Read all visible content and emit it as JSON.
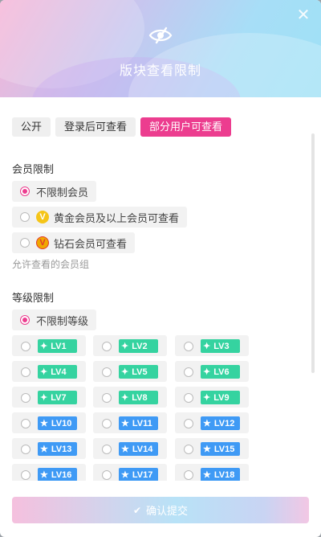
{
  "dialog": {
    "title": "版块查看限制",
    "eye_icon": "eye-slash-icon",
    "close_icon": "close-icon"
  },
  "tabs": [
    {
      "label": "公开",
      "active": false
    },
    {
      "label": "登录后可查看",
      "active": false
    },
    {
      "label": "部分用户可查看",
      "active": true
    }
  ],
  "member": {
    "heading": "会员限制",
    "options": [
      {
        "label": "不限制会员",
        "checked": true,
        "icon": ""
      },
      {
        "label": "黄金会员及以上会员可查看",
        "checked": false,
        "icon": "gold-vip-icon",
        "glyph": "V"
      },
      {
        "label": "钻石会员可查看",
        "checked": false,
        "icon": "diamond-vip-icon",
        "glyph": "V"
      }
    ],
    "hint": "允许查看的会员组"
  },
  "level": {
    "heading": "等级限制",
    "unlimited": {
      "label": "不限制等级",
      "checked": true
    },
    "levels": [
      {
        "label": "LV1",
        "color": "#35d3a0"
      },
      {
        "label": "LV2",
        "color": "#35d3a0"
      },
      {
        "label": "LV3",
        "color": "#35d3a0"
      },
      {
        "label": "LV4",
        "color": "#35d3a0"
      },
      {
        "label": "LV5",
        "color": "#35d3a0"
      },
      {
        "label": "LV6",
        "color": "#35d3a0"
      },
      {
        "label": "LV7",
        "color": "#35d3a0"
      },
      {
        "label": "LV8",
        "color": "#35d3a0"
      },
      {
        "label": "LV9",
        "color": "#35d3a0"
      },
      {
        "label": "LV10",
        "color": "#3f9af5"
      },
      {
        "label": "LV11",
        "color": "#3f9af5"
      },
      {
        "label": "LV12",
        "color": "#3f9af5"
      },
      {
        "label": "LV13",
        "color": "#3f9af5"
      },
      {
        "label": "LV14",
        "color": "#3f9af5"
      },
      {
        "label": "LV15",
        "color": "#3f9af5"
      },
      {
        "label": "LV16",
        "color": "#3f9af5"
      },
      {
        "label": "LV17",
        "color": "#3f9af5"
      },
      {
        "label": "LV18",
        "color": "#3f9af5"
      }
    ]
  },
  "submit": {
    "label": "确认提交",
    "icon": "check-icon"
  },
  "colors": {
    "accent": "#ec3d8f",
    "green_badge": "#35d3a0",
    "blue_badge": "#3f9af5"
  }
}
